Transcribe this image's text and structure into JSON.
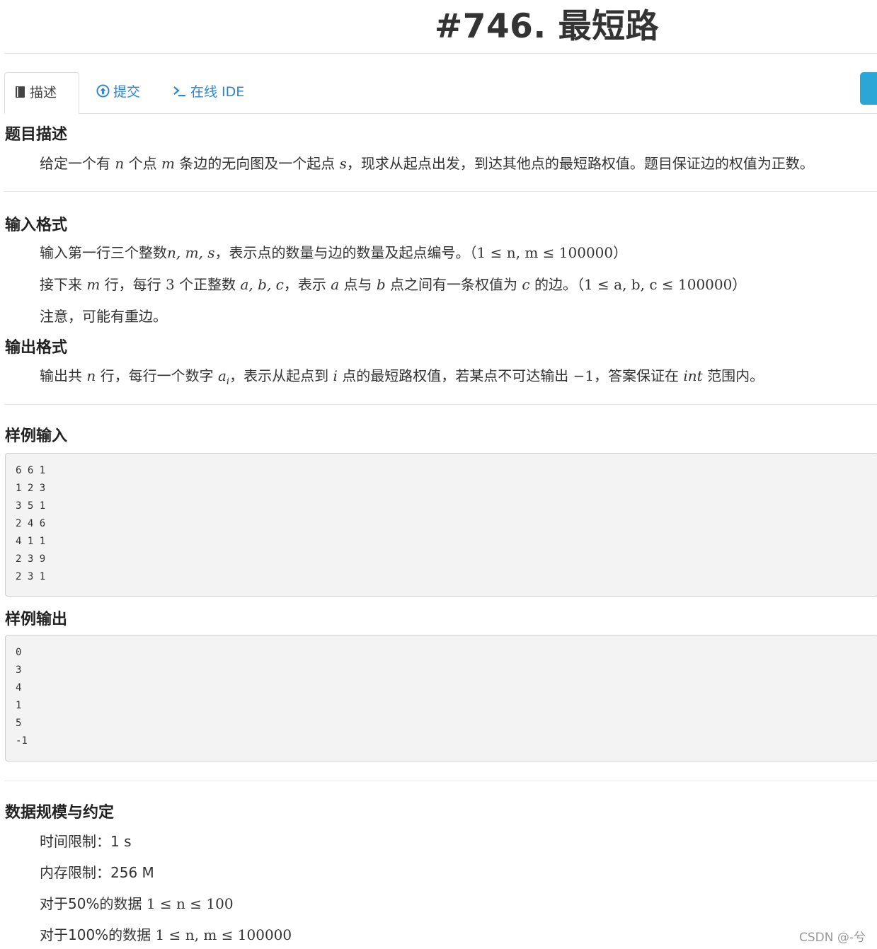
{
  "title": "#746. 最短路",
  "tabs": [
    {
      "label": "描述",
      "icon": "book-icon"
    },
    {
      "label": "提交",
      "icon": "upload-icon"
    },
    {
      "label": "在线 IDE",
      "icon": "terminal-icon"
    }
  ],
  "sections": {
    "desc_h": "题目描述",
    "desc": {
      "a": "给定一个有",
      "n": "n",
      "b": "个点",
      "m": "m",
      "c": "条边的无向图及一个起点",
      "s": "s",
      "d": "，现求从起点出发，到达其他点的最短路权值。题目保证边的权值为正数。"
    },
    "input_h": "输入格式",
    "input1": {
      "a": "输入第一行三个整数",
      "vars": "n, m, s",
      "b": "，表示点的数量与边的数量及起点编号。（",
      "cons": "1 ≤ n, m ≤ 100000",
      "c": "）"
    },
    "input2": {
      "a": "接下来",
      "m": "m",
      "b": "行，每行",
      "three": "3",
      "c": "个正整数",
      "vars": "a, b, c",
      "d": "，表示",
      "av": "a",
      "e": "点与",
      "bv": "b",
      "f": "点之间有一条权值为",
      "cv": "c",
      "g": "的边。（",
      "cons": "1 ≤ a, b, c ≤ 100000",
      "h": "）"
    },
    "input3": "注意，可能有重边。",
    "output_h": "输出格式",
    "output1": {
      "a": "输出共",
      "n": "n",
      "b": "行，每行一个数字",
      "ai": "a",
      "sub": "i",
      "c": "，表示从起点到",
      "i": "i",
      "d": "点的最短路权值，若某点不可达输出",
      "neg": "−1",
      "e": "，答案保证在",
      "int": "int",
      "f": "范围内。"
    },
    "sample_in_h": "样例输入",
    "sample_in": [
      "6 6 1",
      "1 2 3",
      "3 5 1",
      "2 4 6",
      "4 1 1",
      "2 3 9",
      "2 3 1"
    ],
    "sample_out_h": "样例输出",
    "sample_out": [
      "0",
      "3",
      "4",
      "1",
      "5",
      "-1"
    ],
    "limits_h": "数据规模与约定",
    "limits": {
      "time": "时间限制：1 s",
      "mem": "内存限制：256 M",
      "p50a": "对于50%的数据",
      "p50b": "1 ≤ n ≤ 100",
      "p100a": "对于100%的数据",
      "p100b": "1 ≤ n, m ≤ 100000"
    }
  },
  "watermark": "CSDN @-兮",
  "colors": {
    "link": "#2b84d9",
    "side_button": "#2aa7d6",
    "code_bg": "#f3f3f3"
  }
}
